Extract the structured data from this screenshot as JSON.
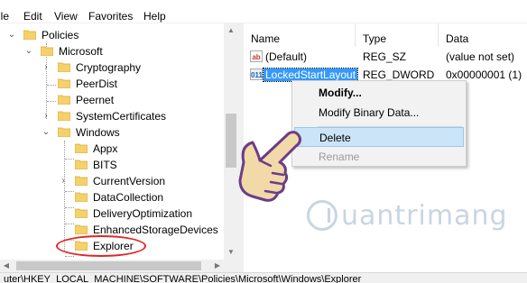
{
  "menu": {
    "items": [
      "ile",
      "Edit",
      "View",
      "Favorites",
      "Help"
    ]
  },
  "tree": {
    "items": [
      {
        "label": "Policies",
        "expander": "collapse"
      },
      {
        "label": "Microsoft",
        "expander": "collapse"
      },
      {
        "label": "Cryptography",
        "expander": "expand"
      },
      {
        "label": "PeerDist",
        "expander": "none"
      },
      {
        "label": "Peernet",
        "expander": "none"
      },
      {
        "label": "SystemCertificates",
        "expander": "expand"
      },
      {
        "label": "Windows",
        "expander": "collapse"
      },
      {
        "label": "Appx",
        "expander": "none"
      },
      {
        "label": "BITS",
        "expander": "none"
      },
      {
        "label": "CurrentVersion",
        "expander": "expand"
      },
      {
        "label": "DataCollection",
        "expander": "none"
      },
      {
        "label": "DeliveryOptimization",
        "expander": "none"
      },
      {
        "label": "EnhancedStorageDevices",
        "expander": "none"
      },
      {
        "label": "Explorer",
        "expander": "none"
      }
    ]
  },
  "list": {
    "columns": [
      "Name",
      "Type",
      "Data"
    ],
    "rows": [
      {
        "icon": "ab",
        "name": "(Default)",
        "type": "REG_SZ",
        "data": "(value not set)"
      },
      {
        "icon": "011",
        "name": "LockedStartLayout",
        "type": "REG_DWORD",
        "data": "0x00000001 (1)"
      }
    ]
  },
  "context_menu": {
    "items": [
      {
        "label": "Modify...",
        "state": "default"
      },
      {
        "label": "Modify Binary Data...",
        "state": "normal"
      },
      {
        "label": "Delete",
        "state": "highlighted"
      },
      {
        "label": "Rename",
        "state": "disabled"
      }
    ]
  },
  "status_bar": {
    "path": "uter\\HKEY_LOCAL_MACHINE\\SOFTWARE\\Policies\\Microsoft\\Windows\\Explorer"
  },
  "watermark": {
    "text": "uantrimang"
  },
  "colors": {
    "selection": "#3399ff",
    "menu_highlight": "#cce4f7",
    "annotation": "#e0262a",
    "folder": "#f5d16b"
  }
}
